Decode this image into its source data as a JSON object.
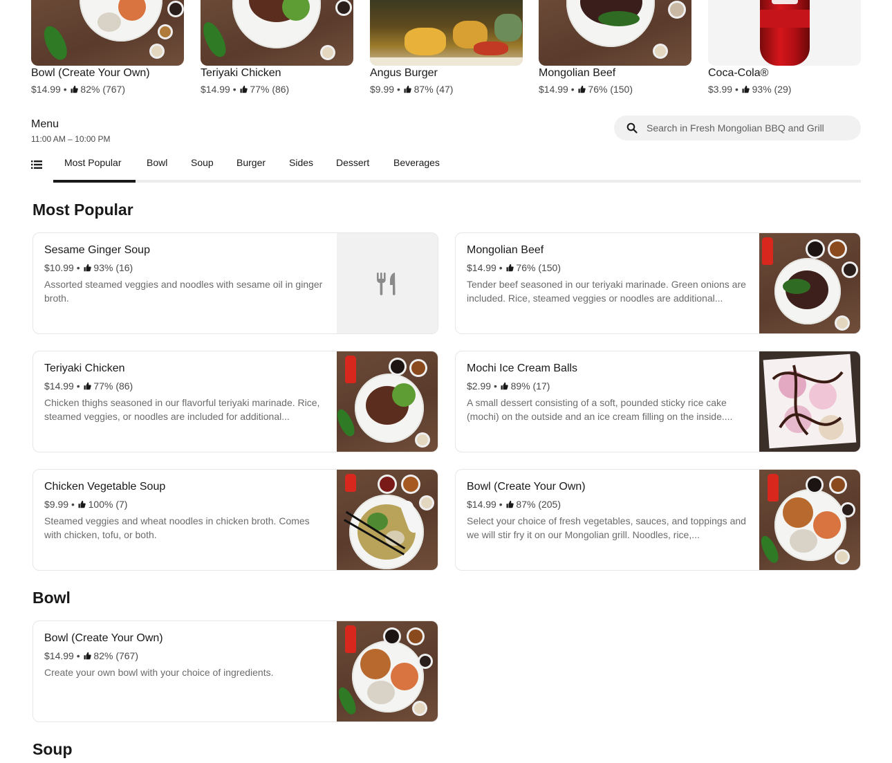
{
  "featured": [
    {
      "name": "Bowl (Create Your Own)",
      "price": "$14.99",
      "rating": "82% (767)"
    },
    {
      "name": "Teriyaki Chicken",
      "price": "$14.99",
      "rating": "77% (86)"
    },
    {
      "name": "Angus Burger",
      "price": "$9.99",
      "rating": "87% (47)"
    },
    {
      "name": "Mongolian Beef",
      "price": "$14.99",
      "rating": "76% (150)"
    },
    {
      "name": "Coca-Cola®",
      "price": "$3.99",
      "rating": "93% (29)"
    }
  ],
  "menu": {
    "title": "Menu",
    "hours": "11:00 AM – 10:00 PM"
  },
  "search": {
    "placeholder": "Search in Fresh Mongolian BBQ and Grill"
  },
  "tabs": [
    "Most Popular",
    "Bowl",
    "Soup",
    "Burger",
    "Sides",
    "Dessert",
    "Beverages"
  ],
  "sections": {
    "most_popular": {
      "title": "Most Popular",
      "items": [
        {
          "name": "Sesame Ginger Soup",
          "price": "$10.99",
          "rating": "93% (16)",
          "desc": "Assorted steamed veggies and noodles with sesame oil in ginger broth."
        },
        {
          "name": "Mongolian Beef",
          "price": "$14.99",
          "rating": "76% (150)",
          "desc": "Tender beef seasoned in our teriyaki marinade. Green onions are included. Rice, steamed veggies or noodles are additional..."
        },
        {
          "name": "Teriyaki Chicken",
          "price": "$14.99",
          "rating": "77% (86)",
          "desc": "Chicken thighs seasoned in our flavorful teriyaki marinade. Rice, steamed veggies, or noodles are included for additional..."
        },
        {
          "name": "Mochi Ice Cream Balls",
          "price": "$2.99",
          "rating": "89% (17)",
          "desc": "A small dessert consisting of a soft, pounded sticky rice cake (mochi) on the outside and an ice cream filling on the inside...."
        },
        {
          "name": "Chicken Vegetable Soup",
          "price": "$9.99",
          "rating": "100% (7)",
          "desc": "Steamed veggies and wheat noodles in chicken broth. Comes with chicken, tofu, or both."
        },
        {
          "name": "Bowl (Create Your Own)",
          "price": "$14.99",
          "rating": "87% (205)",
          "desc": "Select your choice of fresh vegetables, sauces, and toppings and we will stir fry it on our Mongolian grill. Noodles, rice,..."
        }
      ]
    },
    "bowl": {
      "title": "Bowl",
      "items": [
        {
          "name": "Bowl (Create Your Own)",
          "price": "$14.99",
          "rating": "82% (767)",
          "desc": "Create your own bowl with your choice of ingredients."
        }
      ]
    },
    "soup": {
      "title": "Soup"
    }
  },
  "separator": "•"
}
